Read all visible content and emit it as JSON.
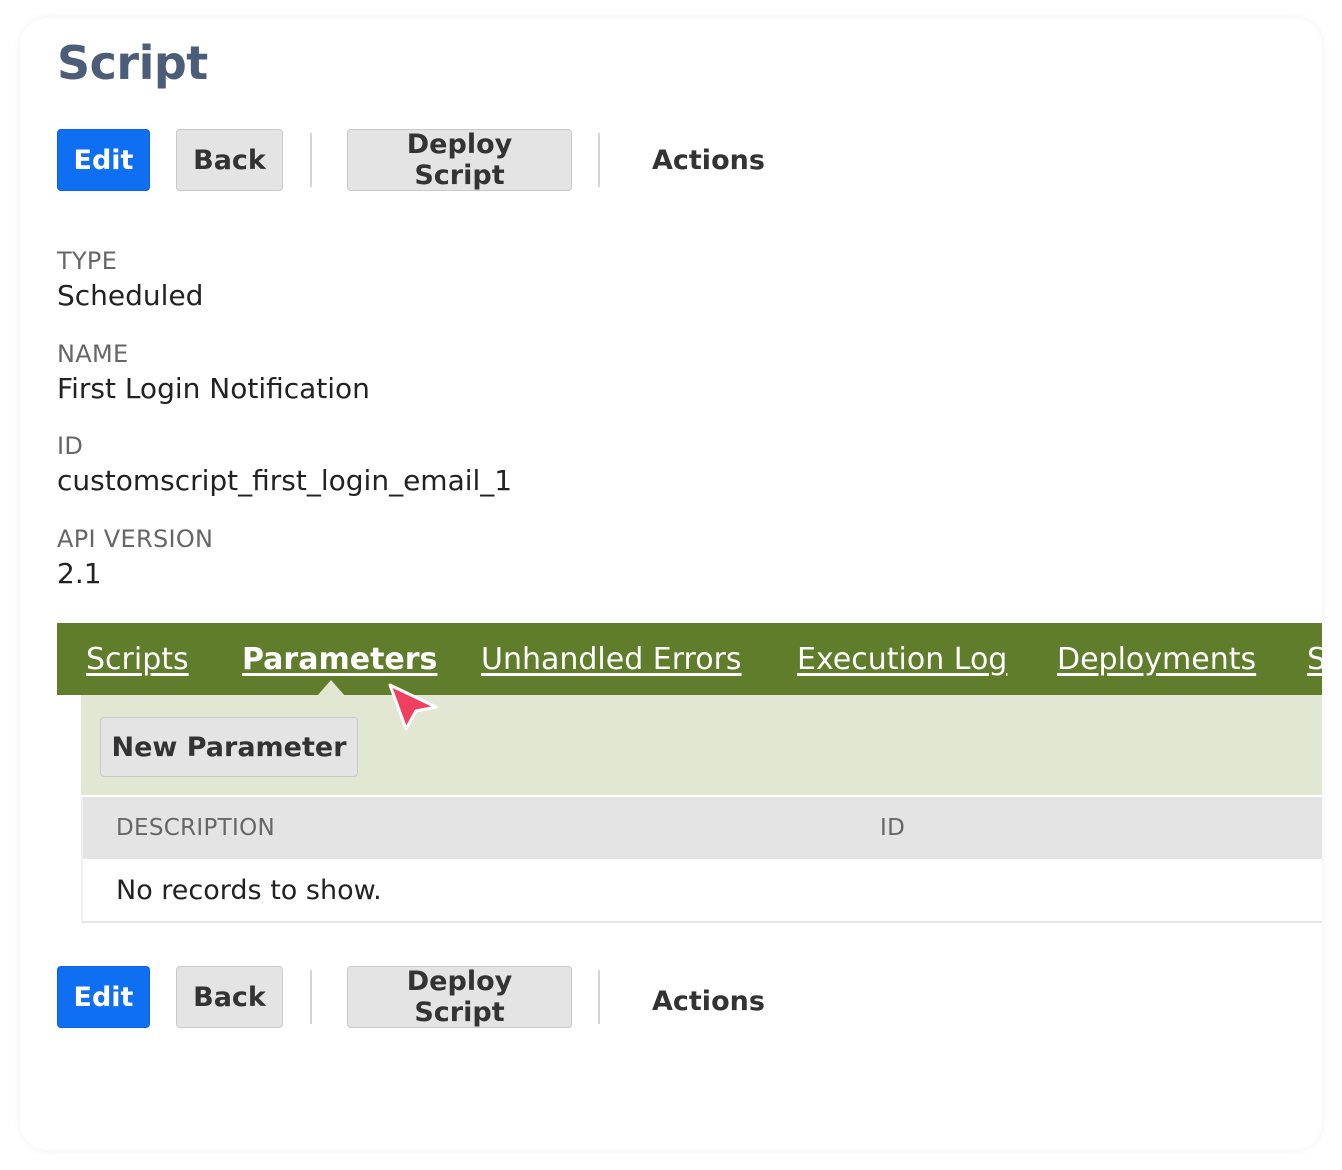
{
  "page": {
    "title": "Script"
  },
  "toolbar": {
    "edit_label": "Edit",
    "back_label": "Back",
    "deploy_label": "Deploy Script",
    "actions_label": "Actions"
  },
  "fields": [
    {
      "label": "TYPE",
      "value": "Scheduled"
    },
    {
      "label": "NAME",
      "value": "First Login Notification"
    },
    {
      "label": "ID",
      "value": "customscript_first_login_email_1"
    },
    {
      "label": "API VERSION",
      "value": "2.1"
    }
  ],
  "tabs": {
    "active": "Parameters",
    "items": [
      {
        "label": "Scripts"
      },
      {
        "label": "Parameters"
      },
      {
        "label": "Unhandled Errors"
      },
      {
        "label": "Execution Log"
      },
      {
        "label": "Deployments"
      },
      {
        "label": "S"
      }
    ]
  },
  "parameters_panel": {
    "new_button_label": "New Parameter",
    "columns": [
      "DESCRIPTION",
      "ID"
    ],
    "empty_message": "No records to show."
  },
  "colors": {
    "primary_button": "#0f6ff2",
    "title": "#4b5d78",
    "tab_bar": "#607d2b",
    "subpanel": "#e2e7d4",
    "cursor": "#f0405f"
  },
  "icons": {
    "pointer": "pointer-cursor-icon"
  }
}
